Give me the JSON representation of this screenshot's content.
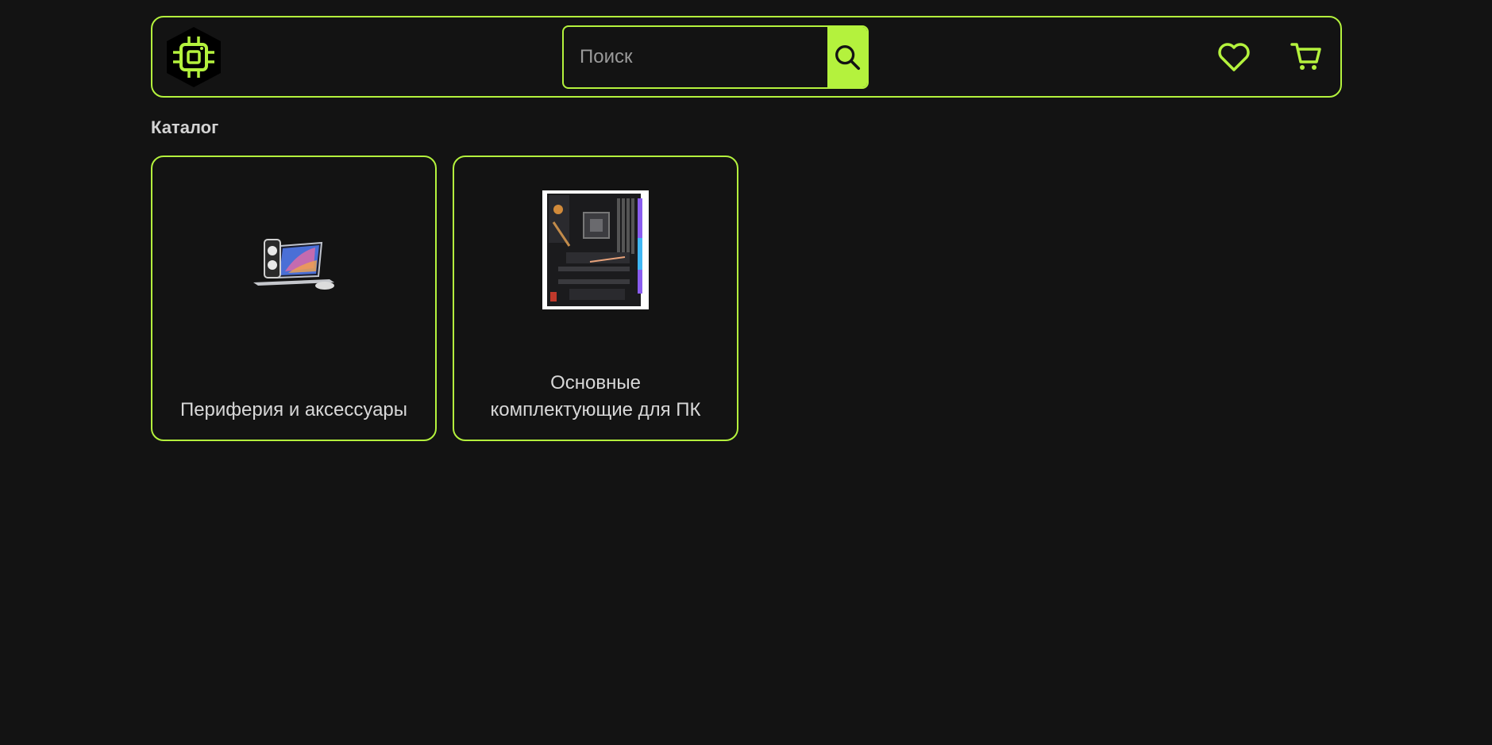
{
  "header": {
    "logo_icon": "chip-logo-icon",
    "search": {
      "placeholder": "Поиск",
      "value": "",
      "button_icon": "search-icon"
    },
    "favorites_icon": "heart-icon",
    "cart_icon": "cart-icon"
  },
  "catalog": {
    "title": "Каталог",
    "categories": [
      {
        "label": "Периферия и аксессуары",
        "image": "peripherals-image"
      },
      {
        "label": "Основные комплектующие для ПК",
        "image": "motherboard-image"
      }
    ]
  },
  "colors": {
    "accent": "#b4f23d",
    "background": "#131313",
    "text": "#d8d8d8"
  }
}
